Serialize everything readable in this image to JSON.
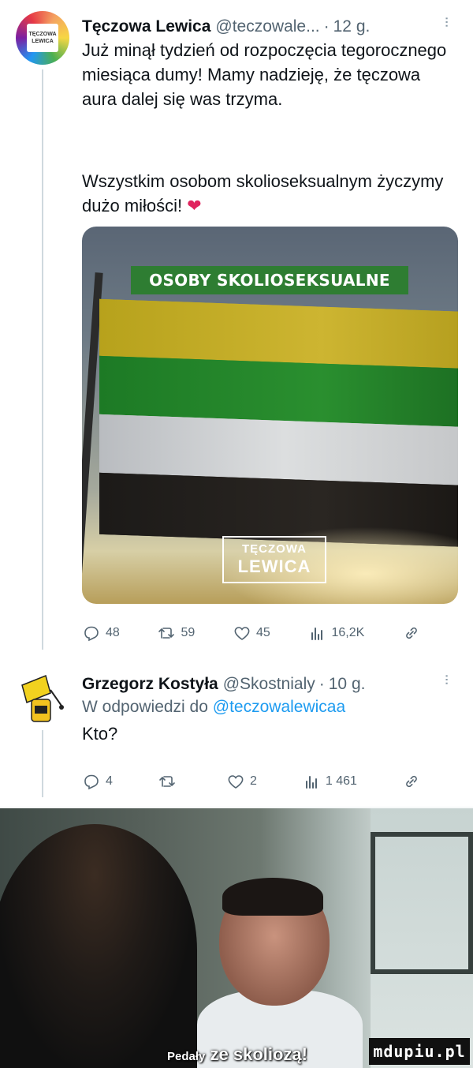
{
  "tweet1": {
    "avatar_badge": [
      "TĘCZOWA",
      "LEWICA"
    ],
    "name": "Tęczowa Lewica",
    "handle": "@teczowale...",
    "time": "12 g.",
    "text_p1": "Już minął tydzień od rozpoczęcia tegorocznego miesiąca dumy! Mamy nadzieję, że tęczowa aura dalej się was trzyma.",
    "text_p2": "Wszystkim osobom skolioseksualnym życzymy dużo miłości!",
    "heart_glyph": "❤",
    "image": {
      "banner": "OSOBY SKOLIOSEKSUALNE",
      "flag_colors": [
        "#c2ab27",
        "#268a2c",
        "#d3d5d7",
        "#231f1c"
      ],
      "logo_line1": "TĘCZOWA",
      "logo_line2": "LEWICA"
    },
    "actions": {
      "replies": "48",
      "retweets": "59",
      "likes": "45",
      "views": "16,2K"
    }
  },
  "tweet2": {
    "name": "Grzegorz Kostyła",
    "handle": "@Skostnialy",
    "time": "10 g.",
    "reply_prefix": "W odpowiedzi do",
    "reply_mention": "@teczowalewicaa",
    "text": "Kto?",
    "actions": {
      "replies": "4",
      "retweets": "",
      "likes": "2",
      "views": "1 461"
    }
  },
  "meme": {
    "caption_small": "Pedały",
    "caption_big": "ze skoliozą!",
    "watermark": "mdupiu.pl"
  },
  "colors": {
    "accent": "#1d9bf0",
    "muted": "#536471",
    "heart": "#e0245e"
  }
}
